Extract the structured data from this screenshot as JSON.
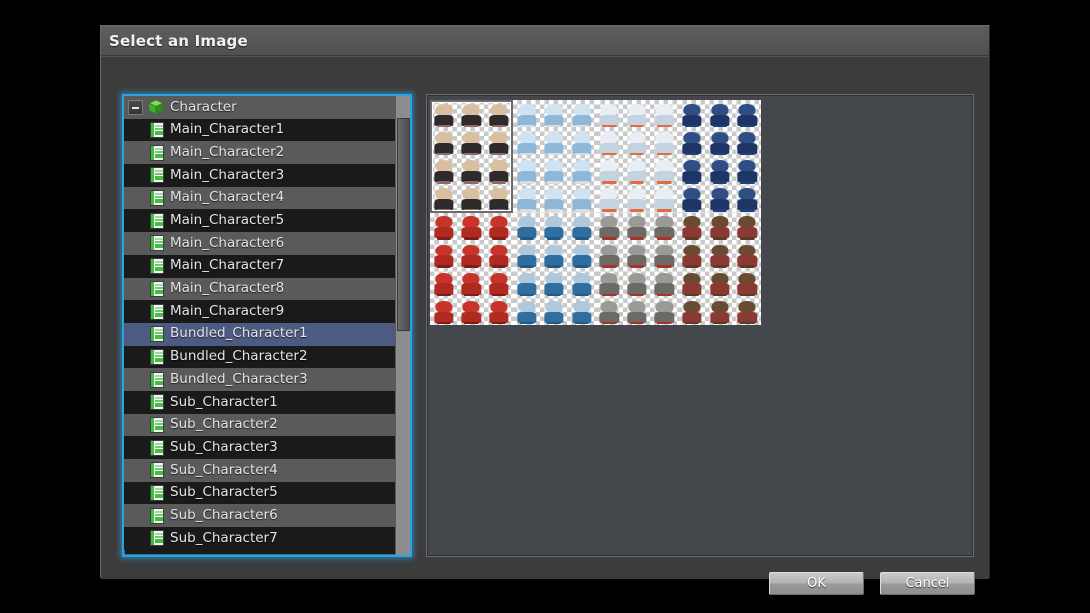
{
  "dialog": {
    "title": "Select an Image"
  },
  "tree": {
    "root": {
      "label": "Character",
      "expander_icon": "minus-icon",
      "folder_icon": "green-cube-icon",
      "expanded": true
    },
    "file_icon": "green-document-icon",
    "selected": "Bundled_Character1",
    "items": [
      {
        "label": "Main_Character1"
      },
      {
        "label": "Main_Character2"
      },
      {
        "label": "Main_Character3"
      },
      {
        "label": "Main_Character4"
      },
      {
        "label": "Main_Character5"
      },
      {
        "label": "Main_Character6"
      },
      {
        "label": "Main_Character7"
      },
      {
        "label": "Main_Character8"
      },
      {
        "label": "Main_Character9"
      },
      {
        "label": "Bundled_Character1"
      },
      {
        "label": "Bundled_Character2"
      },
      {
        "label": "Bundled_Character3"
      },
      {
        "label": "Sub_Character1"
      },
      {
        "label": "Sub_Character2"
      },
      {
        "label": "Sub_Character3"
      },
      {
        "label": "Sub_Character4"
      },
      {
        "label": "Sub_Character5"
      },
      {
        "label": "Sub_Character6"
      },
      {
        "label": "Sub_Character7"
      }
    ]
  },
  "preview": {
    "sheet_name": "Bundled_Character1",
    "selected_block_index": 0,
    "blocks": [
      {
        "index": 0,
        "row": 0,
        "col": 0,
        "head": "#d9bfa0",
        "body": "#2f2b2c",
        "foot": "#8e6a6a"
      },
      {
        "index": 1,
        "row": 0,
        "col": 1,
        "head": "#cfe3f2",
        "body": "#8fb8d8",
        "foot": "#d8dde2"
      },
      {
        "index": 2,
        "row": 0,
        "col": 2,
        "head": "#e8eef4",
        "body": "#c3d3e0",
        "foot": "#e66a3c"
      },
      {
        "index": 3,
        "row": 0,
        "col": 3,
        "head": "#2e4f86",
        "body": "#1e3566",
        "foot": "#20407a"
      },
      {
        "index": 4,
        "row": 1,
        "col": 0,
        "head": "#c8342a",
        "body": "#b02a22",
        "foot": "#7e1d18"
      },
      {
        "index": 5,
        "row": 1,
        "col": 1,
        "head": "#b0c8dc",
        "body": "#2f6e9e",
        "foot": "#1f5a88"
      },
      {
        "index": 6,
        "row": 1,
        "col": 2,
        "head": "#9a9a96",
        "body": "#6d6a66",
        "foot": "#a8312a"
      },
      {
        "index": 7,
        "row": 1,
        "col": 3,
        "head": "#6b4a32",
        "body": "#8a3a33",
        "foot": "#5c3a26"
      }
    ]
  },
  "buttons": {
    "ok": "OK",
    "cancel": "Cancel"
  },
  "colors": {
    "focus_border": "#2ba3e3",
    "selection_row": "#4d5b82",
    "titlebar": "#585858",
    "dialog_body": "#3c3c3c",
    "preview_bg": "#44474c"
  }
}
